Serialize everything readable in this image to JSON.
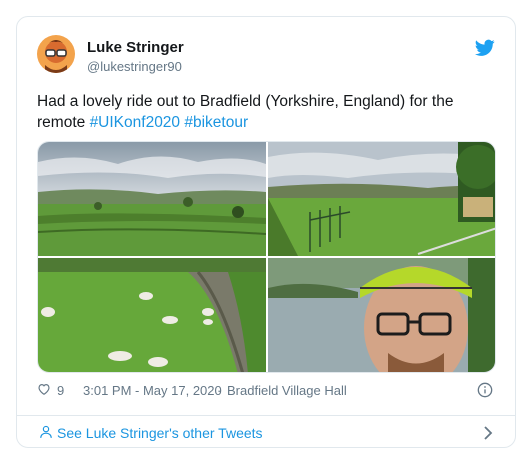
{
  "tweet": {
    "author_name": "Luke Stringer",
    "author_handle": "@lukestringer90",
    "text_before": "Had a lovely ride out to Bradfield (Yorkshire, England) for the remote ",
    "hashtags": [
      "#UIKonf2020",
      "#biketour"
    ],
    "likes": "9",
    "timestamp": "3:01 PM - May 17, 2020",
    "separator": "·",
    "location": "Bradfield Village Hall",
    "footer_link": "See Luke Stringer's other Tweets"
  },
  "icons": {
    "brand": "twitter-bird-icon",
    "like": "heart-icon",
    "info": "info-icon",
    "profile": "person-icon",
    "chevron": "chevron-right-icon"
  },
  "colors": {
    "accent": "#1b95e0",
    "secondary_text": "#657786",
    "border": "#e1e8ed"
  }
}
